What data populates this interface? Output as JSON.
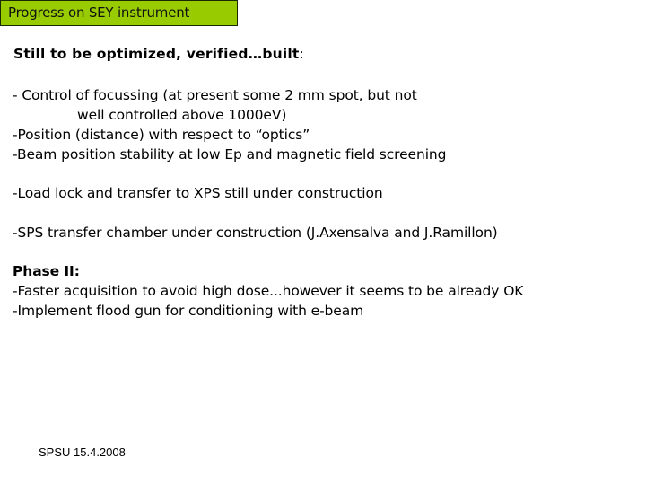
{
  "title": "Progress on SEY instrument",
  "heading": {
    "text": "Still to be optimized, verified…built",
    "colon": ":"
  },
  "items": [
    "- Control of focussing (at present some 2 mm spot, but not",
    "well controlled above 1000eV)",
    "-Position (distance) with respect to “optics”",
    "-Beam position stability at low Ep and magnetic field screening",
    "-Load lock and transfer to XPS still under construction",
    "-SPS transfer chamber under construction (J.Axensalva and J.Ramillon)"
  ],
  "phase2": {
    "heading": "Phase II:",
    "items": [
      "-Faster  acquisition to avoid high dose...however it seems to be already OK",
      "-Implement flood gun for conditioning with e-beam"
    ]
  },
  "footer": "SPSU 15.4.2008",
  "colors": {
    "title_bg": "#99cc00"
  }
}
